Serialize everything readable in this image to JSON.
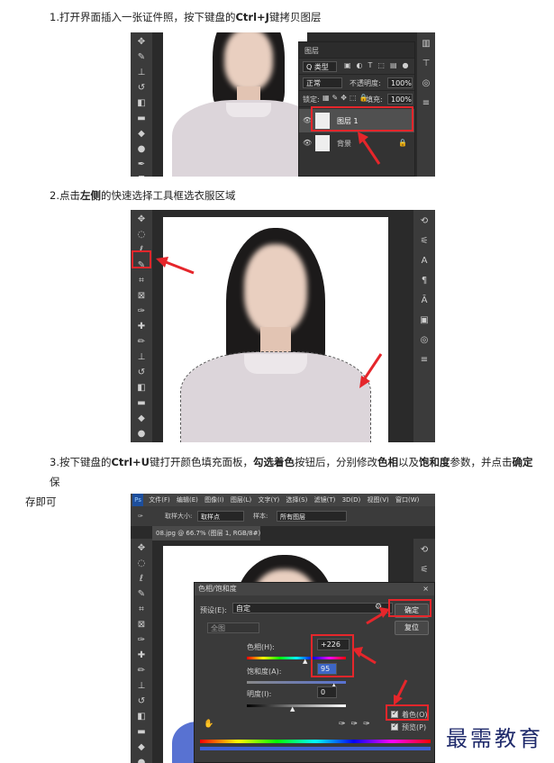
{
  "steps": {
    "step1": {
      "pre": "1.打开界面插入一张证件照，按下键盘的",
      "b1": "Ctrl+J",
      "post": "键拷贝图层"
    },
    "step2": {
      "pre": "2.点击",
      "b1": "左侧",
      "mid": "的快速选择工具框选衣服区域"
    },
    "step3": {
      "pre": "3.按下键盘的",
      "b1": "Ctrl+U",
      "m1": "键打开颜色填充面板，",
      "b2": "勾选着色",
      "m2": "按钮后，分别修改",
      "b3": "色相",
      "m3": "以及",
      "b4": "饱和度",
      "m4": "参数，并点击",
      "b5": "确定",
      "m5": "保",
      "cont": "存即可"
    }
  },
  "layers_panel": {
    "tab": "图层",
    "kind": "Q 类型",
    "blend": "正常",
    "opacity_label": "不透明度:",
    "opacity": "100%",
    "lock_label": "锁定:",
    "fill_label": "填充:",
    "fill": "100%",
    "layer1": "图层 1",
    "layer0": "背景"
  },
  "ps3": {
    "menu": [
      "文件(F)",
      "编辑(E)",
      "图像(I)",
      "图层(L)",
      "文字(Y)",
      "选择(S)",
      "滤镜(T)",
      "3D(D)",
      "视图(V)",
      "窗口(W)"
    ],
    "options_size": "取样大小:",
    "options_size_value": "取样点",
    "options_sample": "样本:",
    "options_sample_value": "所有图层",
    "doc_tab": "08.jpg @ 66.7% (图层 1, RGB/8#) *"
  },
  "dialog": {
    "title": "色相/饱和度",
    "preset_label": "预设(E):",
    "preset_value": "自定",
    "channel": "全图",
    "hue_label": "色相(H):",
    "hue_value": "+226",
    "sat_label": "饱和度(A):",
    "sat_value": "95",
    "light_label": "明度(I):",
    "light_value": "0",
    "ok": "确定",
    "reset": "复位",
    "colorize": "着色(O)",
    "preview": "预览(P)"
  },
  "watermark": "最需教育",
  "colors": {
    "accent": "#e5262b",
    "shirt_blue": "#5872d2"
  }
}
